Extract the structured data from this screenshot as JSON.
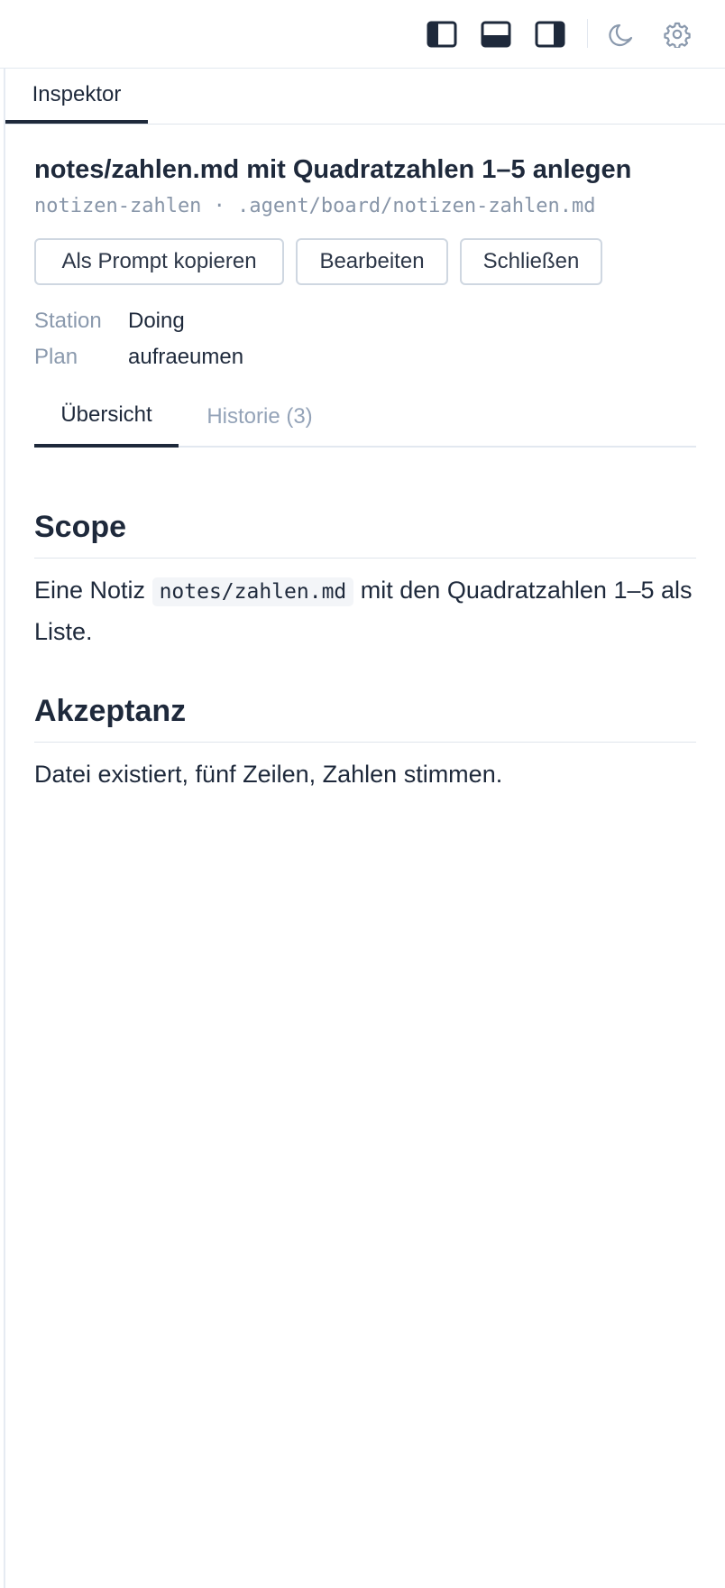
{
  "toolbar": {
    "icons": [
      "layout-left-panel-icon",
      "layout-bottom-panel-icon",
      "layout-right-panel-icon",
      "moon-icon",
      "gear-icon"
    ]
  },
  "panel": {
    "tab_label": "Inspektor"
  },
  "task": {
    "title": "notes/zahlen.md mit Quadratzahlen 1–5 anlegen",
    "subtitle": "notizen-zahlen · .agent/board/notizen-zahlen.md",
    "actions": {
      "copy_prompt": "Als Prompt kopieren",
      "edit": "Bearbeiten",
      "close": "Schließen"
    },
    "meta": {
      "station_label": "Station",
      "station_value": "Doing",
      "plan_label": "Plan",
      "plan_value": "aufraeumen"
    },
    "tabs": {
      "overview": "Übersicht",
      "history": "Historie (3)"
    },
    "sections": {
      "scope_heading": "Scope",
      "scope_text_before": "Eine Notiz ",
      "scope_code": "notes/zahlen.md",
      "scope_text_after": " mit den Quadratzahlen 1–5 als Liste.",
      "acceptance_heading": "Akzeptanz",
      "acceptance_text": "Datei existiert, fünf Zeilen, Zahlen stimmen."
    }
  },
  "colors": {
    "text": "#1e293b",
    "muted": "#8a99ad",
    "border": "#e2e8f0"
  }
}
